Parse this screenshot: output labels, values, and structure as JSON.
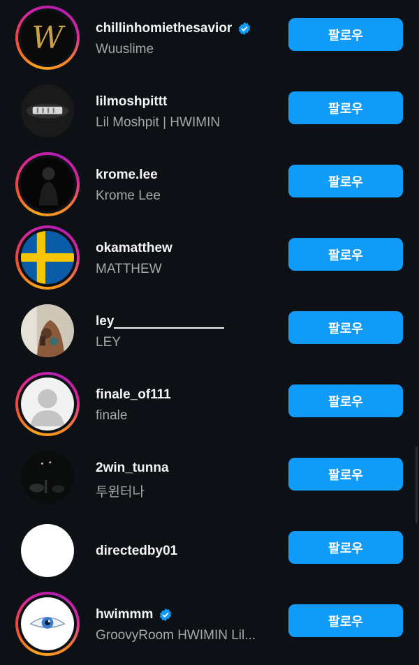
{
  "colors": {
    "background": "#0d1014",
    "follow_button": "#0f9bf7",
    "secondary_text": "#a8a8a8",
    "verified_badge": "#0f9bf7"
  },
  "follow_label": "팔로우",
  "users": [
    {
      "username": "chillinhomiethesavior",
      "full_name": "Wuuslime",
      "verified": true,
      "story_ring": true,
      "avatar_icon": "gold-w-logo-icon"
    },
    {
      "username": "lilmoshpittt",
      "full_name": "Lil Moshpit | HWIMIN",
      "verified": false,
      "story_ring": false,
      "avatar_icon": "teeth-grill-photo"
    },
    {
      "username": "krome.lee",
      "full_name": "Krome Lee",
      "verified": false,
      "story_ring": true,
      "avatar_icon": "dark-person-photo"
    },
    {
      "username": "okamatthew",
      "full_name": "MATTHEW",
      "verified": false,
      "story_ring": true,
      "avatar_icon": "sweden-flag-icon"
    },
    {
      "username": "ley",
      "full_name": "LEY",
      "verified": false,
      "story_ring": false,
      "avatar_icon": "tattoo-mirror-selfie-photo"
    },
    {
      "username": "finale_of111",
      "full_name": "finale",
      "verified": false,
      "story_ring": true,
      "avatar_icon": "default-profile-icon"
    },
    {
      "username": "2win_tunna",
      "full_name": "투윈터나",
      "verified": false,
      "story_ring": false,
      "avatar_icon": "dark-stage-photo"
    },
    {
      "username": "directedby01",
      "full_name": "",
      "verified": false,
      "story_ring": false,
      "avatar_icon": "white-blank-avatar"
    },
    {
      "username": "hwimmm",
      "full_name": "GroovyRoom HWIMIN  Lil...",
      "verified": true,
      "story_ring": true,
      "avatar_icon": "blue-eye-photo"
    }
  ]
}
